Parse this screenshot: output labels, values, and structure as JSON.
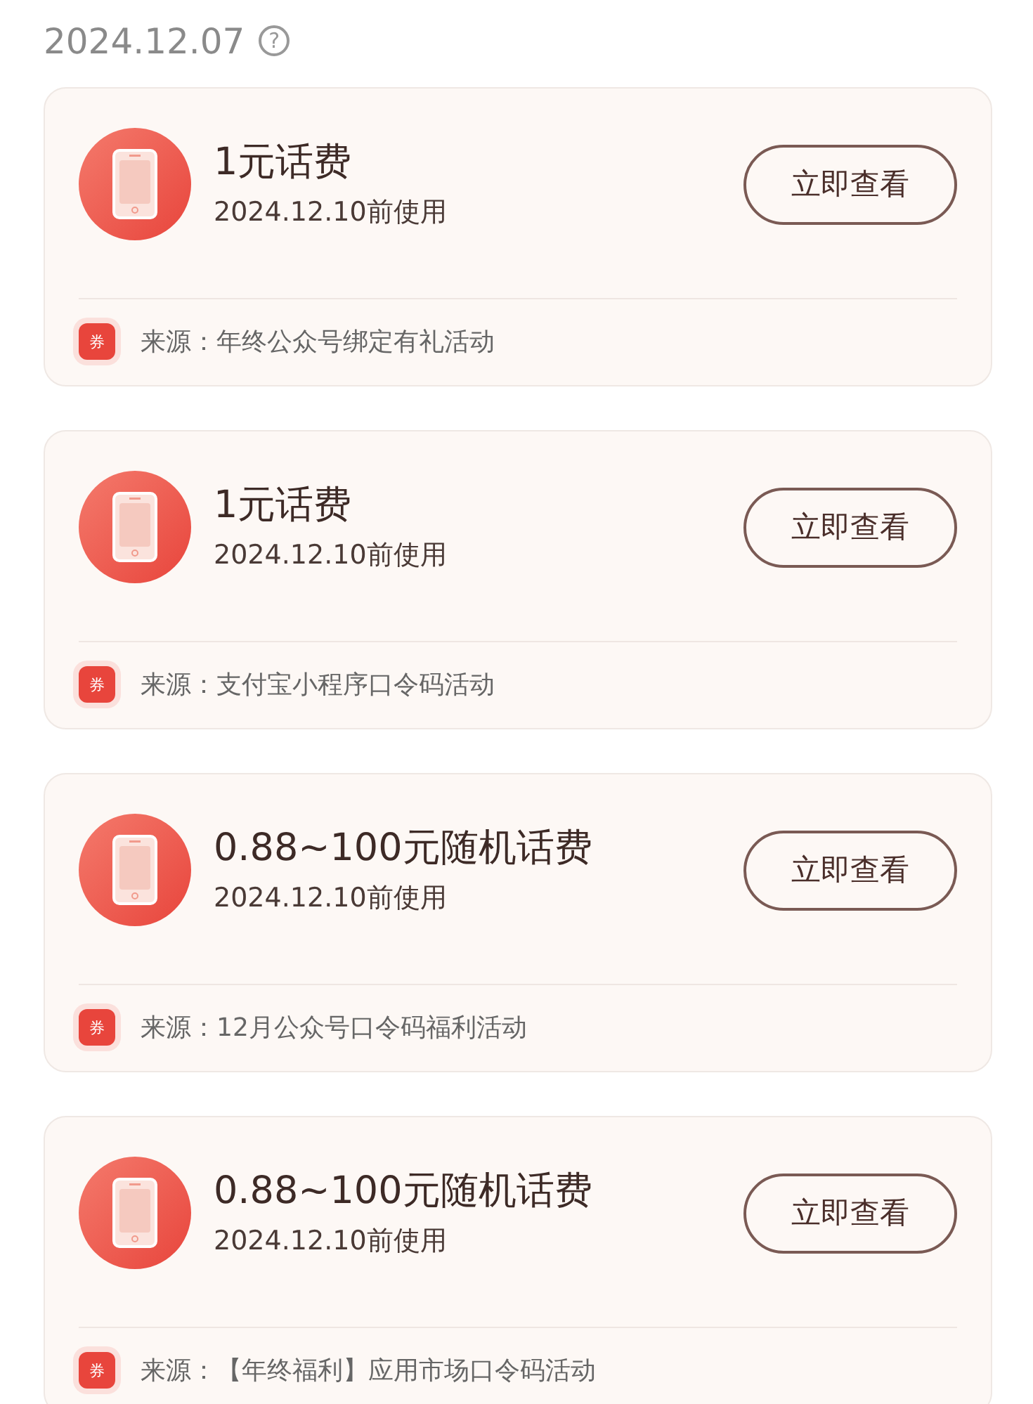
{
  "header": {
    "date": "2024.12.07",
    "help_icon": "?"
  },
  "coupons": [
    {
      "title": "1元话费",
      "expiry": "2024.12.10前使用",
      "button": "立即查看",
      "badge": "券",
      "source": "来源：年终公众号绑定有礼活动"
    },
    {
      "title": "1元话费",
      "expiry": "2024.12.10前使用",
      "button": "立即查看",
      "badge": "券",
      "source": "来源：支付宝小程序口令码活动"
    },
    {
      "title": "0.88~100元随机话费",
      "expiry": "2024.12.10前使用",
      "button": "立即查看",
      "badge": "券",
      "source": "来源：12月公众号口令码福利活动"
    },
    {
      "title": "0.88~100元随机话费",
      "expiry": "2024.12.10前使用",
      "button": "立即查看",
      "badge": "券",
      "source": "来源：【年终福利】应用市场口令码活动"
    }
  ]
}
